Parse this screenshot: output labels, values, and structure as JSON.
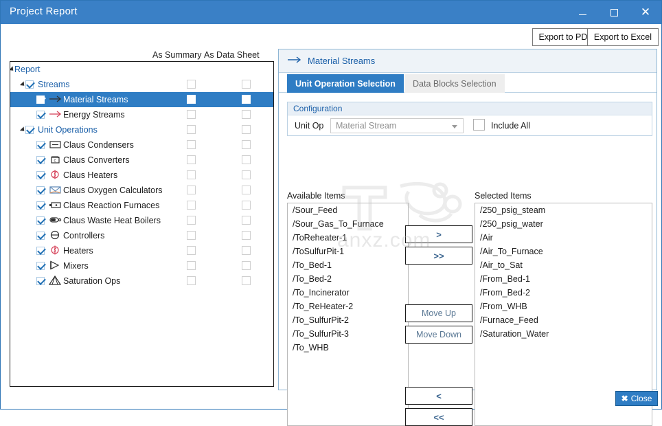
{
  "window": {
    "title": "Project Report",
    "minimize_label": "minimize",
    "maximize_label": "maximize",
    "close_label": "close"
  },
  "toolbar": {
    "export_pdf": "Export to PDF",
    "export_excel": "Export to Excel"
  },
  "tree": {
    "columns": [
      "As Summary",
      "As Data Sheet"
    ],
    "rows": [
      {
        "label": "Report",
        "indent": 6,
        "depth": 0,
        "expander": true,
        "checked": null,
        "icon": null,
        "group": true,
        "selected": false,
        "boxes": false
      },
      {
        "label": "Streams",
        "indent": 22,
        "depth": 1,
        "expander": true,
        "checked": true,
        "icon": null,
        "group": true,
        "selected": false,
        "boxes": true
      },
      {
        "label": "Material Streams",
        "indent": 38,
        "depth": 2,
        "expander": false,
        "checked": true,
        "icon": "arrow-right-black-icon",
        "group": false,
        "selected": true,
        "boxes": true
      },
      {
        "label": "Energy Streams",
        "indent": 38,
        "depth": 2,
        "expander": false,
        "checked": true,
        "icon": "arrow-right-red-icon",
        "group": false,
        "selected": false,
        "boxes": true
      },
      {
        "label": "Unit Operations",
        "indent": 22,
        "depth": 1,
        "expander": true,
        "checked": true,
        "icon": null,
        "group": true,
        "selected": false,
        "boxes": true
      },
      {
        "label": "Claus Condensers",
        "indent": 38,
        "depth": 2,
        "expander": false,
        "checked": true,
        "icon": "condenser-icon",
        "group": false,
        "selected": false,
        "boxes": true
      },
      {
        "label": "Claus Converters",
        "indent": 38,
        "depth": 2,
        "expander": false,
        "checked": true,
        "icon": "converter-icon",
        "group": false,
        "selected": false,
        "boxes": true
      },
      {
        "label": "Claus Heaters",
        "indent": 38,
        "depth": 2,
        "expander": false,
        "checked": true,
        "icon": "heater-icon",
        "group": false,
        "selected": false,
        "boxes": true
      },
      {
        "label": "Claus Oxygen Calculators",
        "indent": 38,
        "depth": 2,
        "expander": false,
        "checked": true,
        "icon": "oxygen-calc-icon",
        "group": false,
        "selected": false,
        "boxes": true
      },
      {
        "label": "Claus Reaction Furnaces",
        "indent": 38,
        "depth": 2,
        "expander": false,
        "checked": true,
        "icon": "furnace-icon",
        "group": false,
        "selected": false,
        "boxes": true
      },
      {
        "label": "Claus Waste Heat Boilers",
        "indent": 38,
        "depth": 2,
        "expander": false,
        "checked": true,
        "icon": "boiler-icon",
        "group": false,
        "selected": false,
        "boxes": true
      },
      {
        "label": "Controllers",
        "indent": 38,
        "depth": 2,
        "expander": false,
        "checked": true,
        "icon": "controller-icon",
        "group": false,
        "selected": false,
        "boxes": true
      },
      {
        "label": "Heaters",
        "indent": 38,
        "depth": 2,
        "expander": false,
        "checked": true,
        "icon": "heater-icon",
        "group": false,
        "selected": false,
        "boxes": true
      },
      {
        "label": "Mixers",
        "indent": 38,
        "depth": 2,
        "expander": false,
        "checked": true,
        "icon": "mixer-icon",
        "group": false,
        "selected": false,
        "boxes": true
      },
      {
        "label": "Saturation Ops",
        "indent": 38,
        "depth": 2,
        "expander": false,
        "checked": true,
        "icon": "saturation-icon",
        "group": false,
        "selected": false,
        "boxes": true
      }
    ]
  },
  "right_panel": {
    "header_title": "Material Streams",
    "header_icon": "arrow-right-icon",
    "tabs": [
      {
        "label": "Unit Operation Selection",
        "active": true
      },
      {
        "label": "Data Blocks Selection",
        "active": false
      }
    ],
    "configuration": {
      "caption": "Configuration",
      "unit_op_label": "Unit Op",
      "unit_op_value": "Material Stream",
      "unit_op_placeholder": "Material Stream",
      "include_all_label": "Include All",
      "include_all_checked": false
    },
    "available": {
      "label": "Available Items",
      "items": [
        "/Sour_Feed",
        "/Sour_Gas_To_Furnace",
        "/ToReheater-1",
        "/ToSulfurPit-1",
        "/To_Bed-1",
        "/To_Bed-2",
        "/To_Incinerator",
        "/To_ReHeater-2",
        "/To_SulfurPit-2",
        "/To_SulfurPit-3",
        "/To_WHB"
      ]
    },
    "selected": {
      "label": "Selected Items",
      "items": [
        "/250_psig_steam",
        "/250_psig_water",
        "/Air",
        "/Air_To_Furnace",
        "/Air_to_Sat",
        "/From_Bed-1",
        "/From_Bed-2",
        "/From_WHB",
        "/Furnace_Feed",
        "/Saturation_Water"
      ]
    },
    "buttons": {
      "move_right": ">",
      "move_right_all": ">>",
      "move_up": "Move Up",
      "move_down": "Move Down",
      "move_left": "<",
      "move_left_all": "<<"
    }
  },
  "footer": {
    "close_label": "Close",
    "close_icon": "close-x-icon"
  },
  "watermark": {
    "text": "anxz.com"
  },
  "colors": {
    "accent": "#2f7dc4",
    "titlebar": "#3a80c6",
    "group_text": "#1a5fa8",
    "panel_border": "#8fb6d4",
    "red_icon": "#d6455c"
  }
}
